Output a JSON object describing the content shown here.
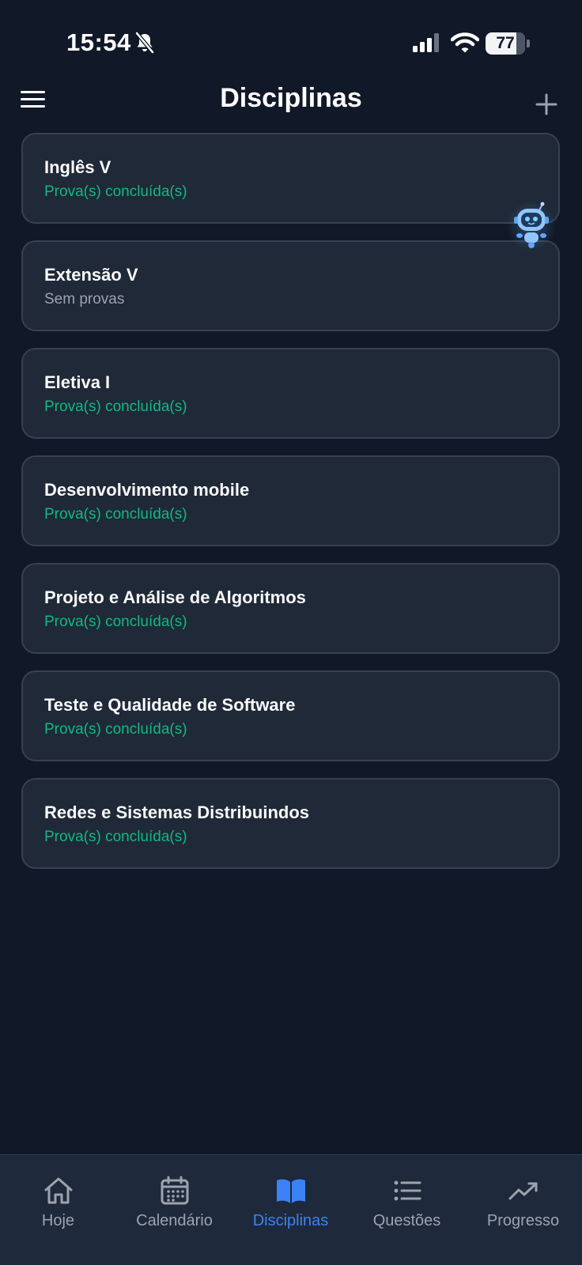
{
  "status_bar": {
    "time": "15:54",
    "battery": "77",
    "battery_level": 0.77,
    "icons": [
      "bell-off-icon",
      "signal-icon",
      "wifi-icon",
      "battery-icon"
    ]
  },
  "header": {
    "title": "Disciplinas",
    "menu_icon": "hamburger-menu-icon",
    "add_icon": "plus-icon"
  },
  "colors": {
    "background": "#111827",
    "card": "#1f2937",
    "card_border": "#374151",
    "status_done": "#10b981",
    "status_none": "#9ca3af",
    "accent": "#3b82f6"
  },
  "disciplines": [
    {
      "name": "Inglês V",
      "status": "Prova(s) concluída(s)",
      "state": "done"
    },
    {
      "name": "Extensão V",
      "status": "Sem provas",
      "state": "none"
    },
    {
      "name": "Eletiva I",
      "status": "Prova(s) concluída(s)",
      "state": "done"
    },
    {
      "name": "Desenvolvimento mobile",
      "status": "Prova(s) concluída(s)",
      "state": "done"
    },
    {
      "name": "Projeto e Análise de Algoritmos",
      "status": "Prova(s) concluída(s)",
      "state": "done"
    },
    {
      "name": "Teste e Qualidade de Software",
      "status": "Prova(s) concluída(s)",
      "state": "done"
    },
    {
      "name": "Redes e Sistemas Distribuindos",
      "status": "Prova(s) concluída(s)",
      "state": "done"
    }
  ],
  "assistant": {
    "icon": "robot-assistant-icon"
  },
  "bottom_nav": {
    "active": "Disciplinas",
    "items": [
      {
        "label": "Hoje",
        "icon": "home-icon"
      },
      {
        "label": "Calendário",
        "icon": "calendar-icon"
      },
      {
        "label": "Disciplinas",
        "icon": "book-icon"
      },
      {
        "label": "Questões",
        "icon": "list-icon"
      },
      {
        "label": "Progresso",
        "icon": "trending-up-icon"
      }
    ]
  }
}
